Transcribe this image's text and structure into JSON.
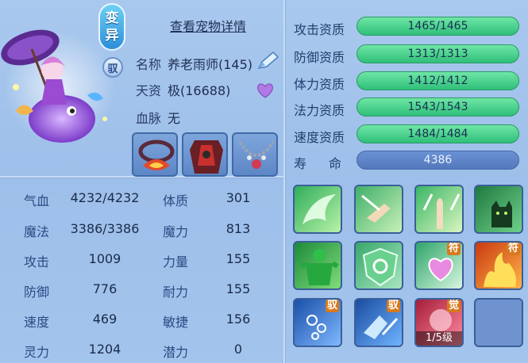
{
  "header": {
    "detail_link": "查看宠物详情"
  },
  "badges": {
    "variant": [
      "变",
      "异"
    ],
    "ride": "驭"
  },
  "info": {
    "name_label": "名称",
    "name_value": "养老雨师(145)",
    "aptitude_label": "天资",
    "aptitude_value": "极(16688)",
    "blood_label": "血脉",
    "blood_value": "无"
  },
  "stats": [
    {
      "k1": "气血",
      "v1": "4232/4232",
      "k2": "体质",
      "v2": "301"
    },
    {
      "k1": "魔法",
      "v1": "3386/3386",
      "k2": "魔力",
      "v2": "813"
    },
    {
      "k1": "攻击",
      "v1": "1009",
      "k2": "力量",
      "v2": "155"
    },
    {
      "k1": "防御",
      "v1": "776",
      "k2": "耐力",
      "v2": "155"
    },
    {
      "k1": "速度",
      "v1": "469",
      "k2": "敏捷",
      "v2": "156"
    },
    {
      "k1": "灵力",
      "v1": "1204",
      "k2": "潜力",
      "v2": "0"
    }
  ],
  "attributes": [
    {
      "label": "攻击资质",
      "value": "1465/1465"
    },
    {
      "label": "防御资质",
      "value": "1313/1313"
    },
    {
      "label": "体力资质",
      "value": "1412/1412"
    },
    {
      "label": "法力资质",
      "value": "1543/1543"
    },
    {
      "label": "速度资质",
      "value": "1484/1484"
    },
    {
      "label": "寿　命",
      "value": "4386"
    }
  ],
  "skills": {
    "tag_fu": "符",
    "tag_yu": "驭",
    "tag_jue": "觉",
    "level": "1/5级"
  },
  "colors": {
    "bar_green": "#3fcf86",
    "bar_blue": "#5a80c4",
    "accent": "#d8791c"
  }
}
